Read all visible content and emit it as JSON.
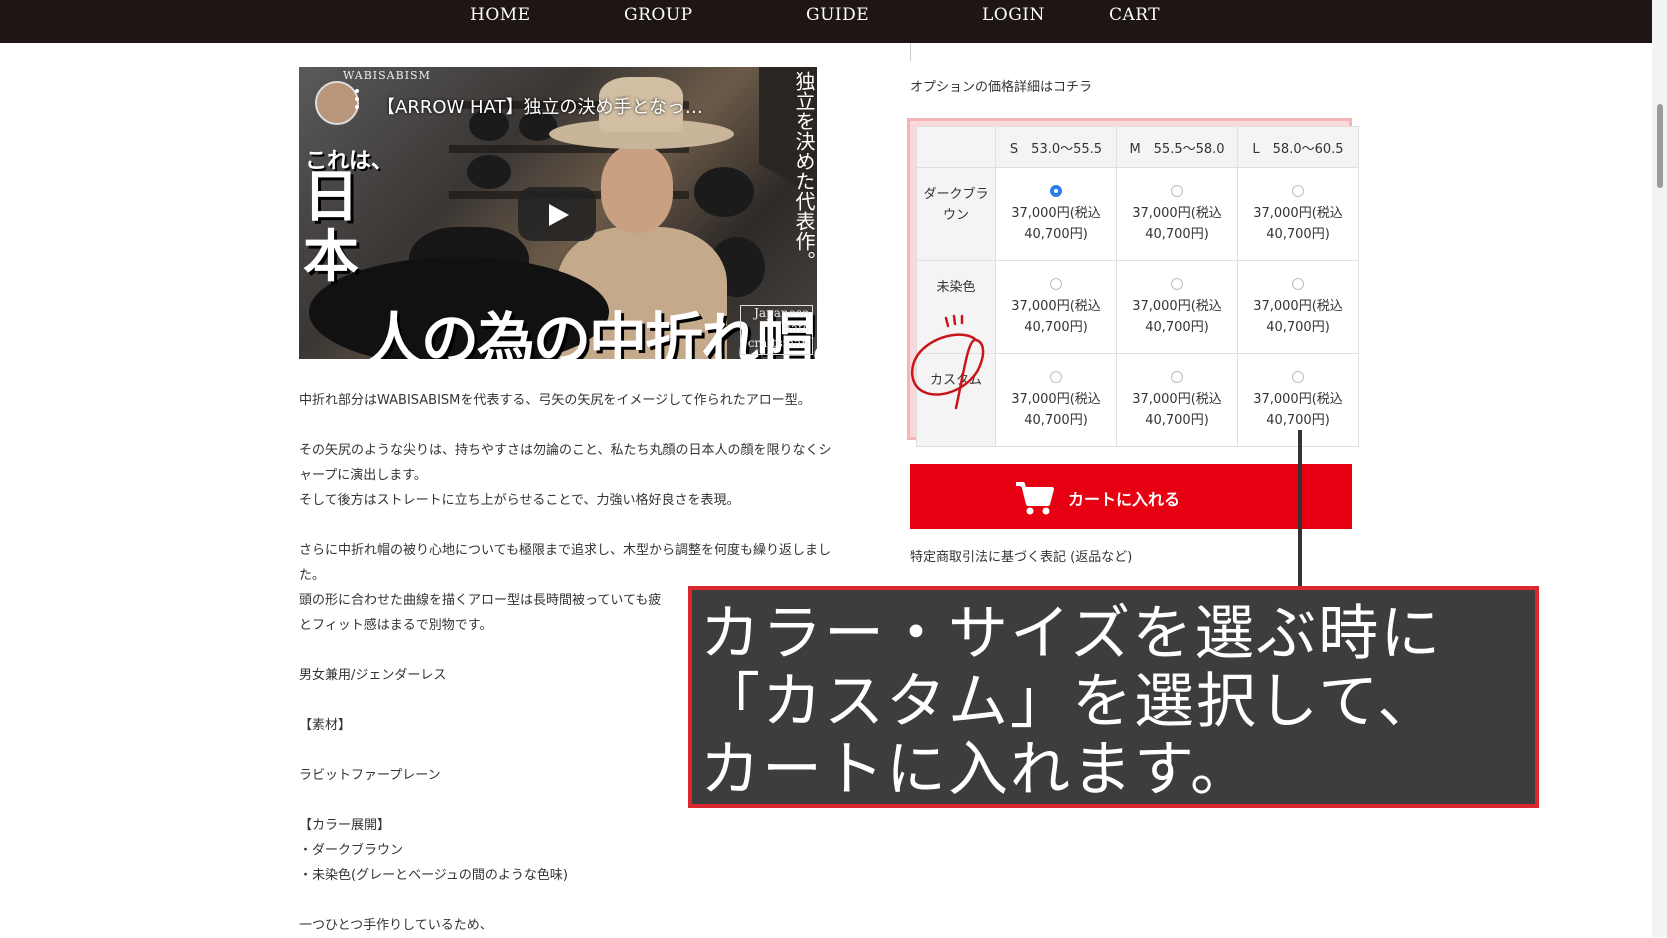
{
  "nav": {
    "items": [
      "HOME",
      "GROUP",
      "GUIDE",
      "LOGIN",
      "CART"
    ]
  },
  "video": {
    "channel": "WABISABISM",
    "title": "【ARROW HAT】独立の決め手となっ…",
    "thumb_vertical": "独立を決めた代表作。",
    "thumb_line1": "これは、",
    "thumb_line2": "日本",
    "thumb_line3": "人の為の中折れ帽。",
    "badge_line1": "Japanese",
    "badge_line2": "hats",
    "badge_line3": "craftsman"
  },
  "description": {
    "p1": "中折れ部分はWABISABISMを代表する、弓矢の矢尻をイメージして作られたアロー型。",
    "p2a": "その矢尻のような尖りは、持ちやすさは勿論のこと、私たち丸顔の日本人の顔を限りなくシ",
    "p2b": "ャープに演出します。",
    "p2c": "そして後方はストレートに立ち上がらせることで、力強い格好良さを表現。",
    "p3a": "さらに中折れ帽の被り心地についても極限まで追求し、木型から調整を何度も繰り返しまし",
    "p3b": "た。",
    "p3c": "頭の形に合わせた曲線を描くアロー型は長時間被っていても疲",
    "p3d": "とフィット感はまるで別物です。",
    "p4": "男女兼用/ジェンダーレス",
    "p5": "【素材】",
    "p6": "ラビットファープレーン",
    "p7": "【カラー展開】",
    "p8": "・ダークブラウン",
    "p9": "・未染色(グレーとベージュの間のような色味)",
    "p10": "一つひとつ手作りしているため、"
  },
  "options": {
    "link": "オプションの価格詳細はコチラ",
    "sizes": [
      "S　53.0〜55.5",
      "M　55.5〜58.0",
      "L　58.0〜60.5"
    ],
    "colors": [
      "ダークブラウン",
      "未染色",
      "カスタム"
    ],
    "price_line1": "37,000円(税込",
    "price_line2": "40,700円)",
    "selected": "ダークブラウン / S"
  },
  "cart": {
    "label": "カートに入れる"
  },
  "law_link": "特定商取引法に基づく表記 (返品など)",
  "callout": {
    "line1": "カラー・サイズを選ぶ時に",
    "line2": "「カスタム」を選択して、",
    "line3": "カートに入れます。"
  },
  "colors": {
    "nav_bg": "#1e1614",
    "cart_red": "#e60012",
    "radio_selected": "#2b7de9",
    "callout_border": "#d9282f",
    "callout_bg": "#3d3d3d",
    "highlight_pink": "#f4b5b8"
  }
}
